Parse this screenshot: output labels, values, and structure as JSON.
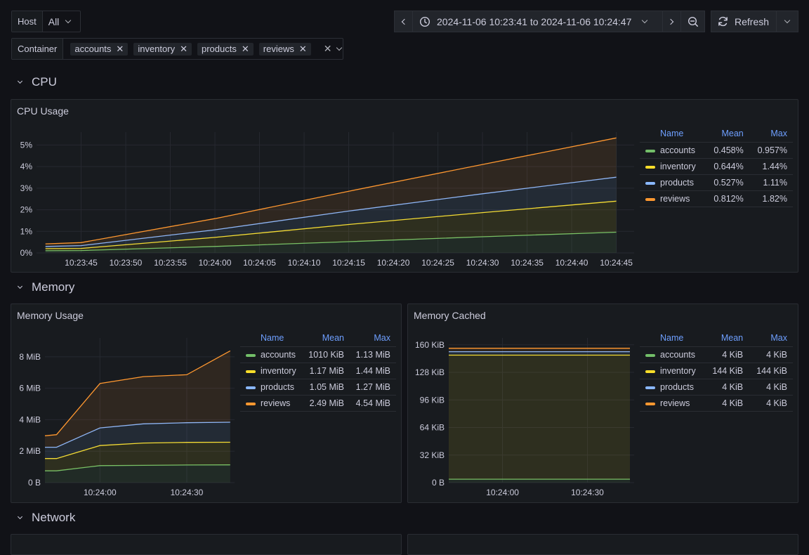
{
  "filters": {
    "host": {
      "label": "Host",
      "value": "All"
    },
    "container": {
      "label": "Container",
      "chips": [
        "accounts",
        "inventory",
        "products",
        "reviews"
      ]
    }
  },
  "timepicker": {
    "range": "2024-11-06 10:23:41 to 2024-11-06 10:24:47",
    "refresh_label": "Refresh"
  },
  "rows": {
    "cpu": "CPU",
    "memory": "Memory",
    "network": "Network"
  },
  "series_colors": {
    "accounts": "#73bf69",
    "inventory": "#fade2a",
    "products": "#8ab8ff",
    "reviews": "#ff9830"
  },
  "panels": {
    "cpu": {
      "title": "CPU Usage",
      "legend": {
        "headers": [
          "Name",
          "Mean",
          "Max"
        ],
        "rows": [
          {
            "name": "accounts",
            "mean": "0.458%",
            "max": "0.957%"
          },
          {
            "name": "inventory",
            "mean": "0.644%",
            "max": "1.44%"
          },
          {
            "name": "products",
            "mean": "0.527%",
            "max": "1.11%"
          },
          {
            "name": "reviews",
            "mean": "0.812%",
            "max": "1.82%"
          }
        ]
      }
    },
    "mem_usage": {
      "title": "Memory Usage",
      "legend": {
        "headers": [
          "Name",
          "Mean",
          "Max"
        ],
        "rows": [
          {
            "name": "accounts",
            "mean": "1010 KiB",
            "max": "1.13 MiB"
          },
          {
            "name": "inventory",
            "mean": "1.17 MiB",
            "max": "1.44 MiB"
          },
          {
            "name": "products",
            "mean": "1.05 MiB",
            "max": "1.27 MiB"
          },
          {
            "name": "reviews",
            "mean": "2.49 MiB",
            "max": "4.54 MiB"
          }
        ]
      }
    },
    "mem_cached": {
      "title": "Memory Cached",
      "legend": {
        "headers": [
          "Name",
          "Mean",
          "Max"
        ],
        "rows": [
          {
            "name": "accounts",
            "mean": "4 KiB",
            "max": "4 KiB"
          },
          {
            "name": "inventory",
            "mean": "144 KiB",
            "max": "144 KiB"
          },
          {
            "name": "products",
            "mean": "4 KiB",
            "max": "4 KiB"
          },
          {
            "name": "reviews",
            "mean": "4 KiB",
            "max": "4 KiB"
          }
        ]
      }
    }
  },
  "chart_data": [
    {
      "id": "cpu",
      "type": "area",
      "stacked": true,
      "title": "CPU Usage",
      "x": [
        0,
        4,
        19,
        34,
        49,
        64
      ],
      "x_unit": "seconds after 10:23:41",
      "xticks": [
        4,
        9,
        14,
        19,
        24,
        29,
        34,
        39,
        44,
        49,
        54,
        59,
        64
      ],
      "xtick_labels": [
        "10:23:45",
        "10:23:50",
        "10:23:55",
        "10:24:00",
        "10:24:05",
        "10:24:10",
        "10:24:15",
        "10:24:20",
        "10:24:25",
        "10:24:30",
        "10:24:35",
        "10:24:40",
        "10:24:45"
      ],
      "xlim": [
        -1,
        66
      ],
      "ylim": [
        0,
        5.6
      ],
      "yticks": [
        0,
        1,
        2,
        3,
        4,
        5
      ],
      "ytick_labels": [
        "0%",
        "1%",
        "2%",
        "3%",
        "4%",
        "5%"
      ],
      "series": [
        {
          "name": "accounts",
          "values": [
            0.1,
            0.11,
            0.3,
            0.52,
            0.75,
            0.96
          ]
        },
        {
          "name": "inventory",
          "values": [
            0.1,
            0.1,
            0.42,
            0.8,
            1.12,
            1.44
          ]
        },
        {
          "name": "products",
          "values": [
            0.1,
            0.13,
            0.35,
            0.62,
            0.87,
            1.11
          ]
        },
        {
          "name": "reviews",
          "values": [
            0.12,
            0.14,
            0.52,
            0.92,
            1.36,
            1.82
          ]
        }
      ]
    },
    {
      "id": "mem_usage",
      "type": "area",
      "stacked": true,
      "title": "Memory Usage",
      "x": [
        0,
        4,
        19,
        34,
        49,
        64
      ],
      "x_unit": "seconds after 10:23:41",
      "xticks": [
        19,
        49
      ],
      "xtick_labels": [
        "10:24:00",
        "10:24:30"
      ],
      "xlim": [
        0,
        65.5
      ],
      "ylim": [
        0,
        9.2
      ],
      "yticks": [
        0,
        2,
        4,
        6,
        8
      ],
      "ytick_labels": [
        "0 B",
        "2 MiB",
        "4 MiB",
        "6 MiB",
        "8 MiB"
      ],
      "series": [
        {
          "name": "accounts",
          "values": [
            0.75,
            0.75,
            1.08,
            1.1,
            1.12,
            1.13
          ]
        },
        {
          "name": "inventory",
          "values": [
            0.78,
            0.78,
            1.28,
            1.42,
            1.44,
            1.44
          ]
        },
        {
          "name": "products",
          "values": [
            0.72,
            0.72,
            1.12,
            1.22,
            1.25,
            1.27
          ]
        },
        {
          "name": "reviews",
          "values": [
            0.73,
            0.8,
            2.82,
            3.0,
            3.05,
            4.54
          ]
        }
      ]
    },
    {
      "id": "mem_cached",
      "type": "area",
      "stacked": true,
      "title": "Memory Cached",
      "x": [
        0,
        64
      ],
      "x_unit": "seconds after 10:23:41",
      "xticks": [
        19,
        49
      ],
      "xtick_labels": [
        "10:24:00",
        "10:24:30"
      ],
      "xlim": [
        0,
        65.5
      ],
      "ylim": [
        0,
        168
      ],
      "yticks": [
        0,
        32,
        64,
        96,
        128,
        160
      ],
      "ytick_labels": [
        "0 B",
        "32 KiB",
        "64 KiB",
        "96 KiB",
        "128 KiB",
        "160 KiB"
      ],
      "series": [
        {
          "name": "accounts",
          "values": [
            4,
            4
          ]
        },
        {
          "name": "inventory",
          "values": [
            144,
            144
          ]
        },
        {
          "name": "products",
          "values": [
            4,
            4
          ]
        },
        {
          "name": "reviews",
          "values": [
            4,
            4
          ]
        }
      ]
    }
  ]
}
